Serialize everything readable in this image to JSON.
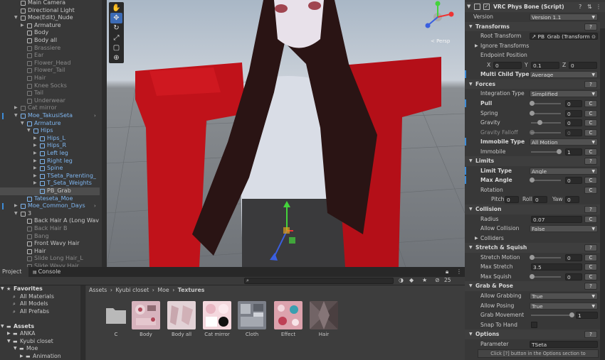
{
  "hierarchy": {
    "items": [
      {
        "label": "Main Camera",
        "indent": 1,
        "state": "normal",
        "arrow": ""
      },
      {
        "label": "Directional Light",
        "indent": 1,
        "state": "normal",
        "arrow": ""
      },
      {
        "label": "Moe(Edit)_Nude",
        "indent": 1,
        "state": "normal",
        "arrow": "down"
      },
      {
        "label": "Armature",
        "indent": 2,
        "state": "normal",
        "arrow": "right"
      },
      {
        "label": "Body",
        "indent": 2,
        "state": "normal",
        "arrow": ""
      },
      {
        "label": "Body all",
        "indent": 2,
        "state": "normal",
        "arrow": ""
      },
      {
        "label": "Brassiere",
        "indent": 2,
        "state": "dim",
        "arrow": ""
      },
      {
        "label": "Ear",
        "indent": 2,
        "state": "dim",
        "arrow": ""
      },
      {
        "label": "Flower_Head",
        "indent": 2,
        "state": "dim",
        "arrow": ""
      },
      {
        "label": "Flower_Tail",
        "indent": 2,
        "state": "dim",
        "arrow": ""
      },
      {
        "label": "Hair",
        "indent": 2,
        "state": "dim",
        "arrow": ""
      },
      {
        "label": "Knee Socks",
        "indent": 2,
        "state": "dim",
        "arrow": ""
      },
      {
        "label": "Tail",
        "indent": 2,
        "state": "dim",
        "arrow": ""
      },
      {
        "label": "Underwear",
        "indent": 2,
        "state": "dim",
        "arrow": ""
      },
      {
        "label": "Cat mirror",
        "indent": 1,
        "state": "dim",
        "arrow": "right"
      },
      {
        "label": "Moe_TakusiSeta",
        "indent": 1,
        "state": "blue",
        "arrow": "down"
      },
      {
        "label": "Armature",
        "indent": 2,
        "state": "blue",
        "arrow": "down"
      },
      {
        "label": "Hips",
        "indent": 3,
        "state": "blue",
        "arrow": "down"
      },
      {
        "label": "Hips_L",
        "indent": 4,
        "state": "blue",
        "arrow": "right"
      },
      {
        "label": "Hips_R",
        "indent": 4,
        "state": "blue",
        "arrow": "right"
      },
      {
        "label": "Left leg",
        "indent": 4,
        "state": "blue",
        "arrow": "right"
      },
      {
        "label": "Right leg",
        "indent": 4,
        "state": "blue",
        "arrow": "right"
      },
      {
        "label": "Spine",
        "indent": 4,
        "state": "blue",
        "arrow": "right"
      },
      {
        "label": "TSeta_Parenting_",
        "indent": 4,
        "state": "blue",
        "arrow": "right"
      },
      {
        "label": "T_Seta_Weights",
        "indent": 4,
        "state": "blue",
        "arrow": "right"
      },
      {
        "label": "PB_Grab",
        "indent": 4,
        "state": "selected",
        "arrow": ""
      },
      {
        "label": "Tateseta_Moe",
        "indent": 2,
        "state": "blue",
        "arrow": ""
      },
      {
        "label": "Moe_Common_Days",
        "indent": 1,
        "state": "blue",
        "arrow": "right"
      },
      {
        "label": "3",
        "indent": 1,
        "state": "normal",
        "arrow": "down"
      },
      {
        "label": "Back Hair A (Long Wav",
        "indent": 2,
        "state": "normal",
        "arrow": ""
      },
      {
        "label": "Back Hair B",
        "indent": 2,
        "state": "dim",
        "arrow": ""
      },
      {
        "label": "Bang",
        "indent": 2,
        "state": "dim",
        "arrow": ""
      },
      {
        "label": "Front Wavy Hair",
        "indent": 2,
        "state": "normal",
        "arrow": ""
      },
      {
        "label": "Hair",
        "indent": 2,
        "state": "normal",
        "arrow": ""
      },
      {
        "label": "Slide Long Hair_L",
        "indent": 2,
        "state": "dim",
        "arrow": ""
      },
      {
        "label": "Slide Wavy Hair",
        "indent": 2,
        "state": "dim",
        "arrow": ""
      }
    ]
  },
  "scene": {
    "persp_label": "< Persp",
    "tools": [
      "hand-tool",
      "move-tool",
      "rotate-tool",
      "scale-tool",
      "rect-tool",
      "transform-tool"
    ]
  },
  "inspector": {
    "component_title": "VRC Phys Bone (Script)",
    "help": "?",
    "version_label": "Version",
    "version_value": "Version 1.1",
    "transforms_header": "Transforms",
    "root_transform_label": "Root Transform",
    "root_transform_value": "↗ PB_Grab (Transform",
    "ignore_transforms_label": "Ignore Transforms",
    "endpoint_position_label": "Endpoint Position",
    "endpoint": {
      "x_label": "X",
      "x": "0",
      "y_label": "Y",
      "y": "0.1",
      "z_label": "Z",
      "z": "0"
    },
    "multi_child_label": "Multi Child Type",
    "multi_child_value": "Average",
    "forces_header": "Forces",
    "integration_label": "Integration Type",
    "integration_value": "Simplified",
    "pull_label": "Pull",
    "pull_value": "0",
    "spring_label": "Spring",
    "spring_value": "0",
    "gravity_label": "Gravity",
    "gravity_value": "0",
    "gravity_falloff_label": "Gravity Falloff",
    "gravity_falloff_value": "0",
    "immobile_type_label": "Immobile Type",
    "immobile_type_value": "All Motion",
    "immobile_label": "Immobile",
    "immobile_value": "1",
    "limits_header": "Limits",
    "limit_type_label": "Limit Type",
    "limit_type_value": "Angle",
    "max_angle_label": "Max Angle",
    "max_angle_value": "0",
    "rotation_label": "Rotation",
    "rotation": {
      "pitch_label": "Pitch",
      "pitch": "0",
      "roll_label": "Roll",
      "roll": "0",
      "yaw_label": "Yaw",
      "yaw": "0"
    },
    "collision_header": "Collision",
    "radius_label": "Radius",
    "radius_value": "0.07",
    "allow_collision_label": "Allow Collision",
    "allow_collision_value": "False",
    "colliders_label": "Colliders",
    "stretch_header": "Stretch & Squish",
    "stretch_motion_label": "Stretch Motion",
    "stretch_motion_value": "0",
    "max_stretch_label": "Max Stretch",
    "max_stretch_value": "3.5",
    "max_squish_label": "Max Squish",
    "max_squish_value": "0",
    "grab_header": "Grab & Pose",
    "allow_grabbing_label": "Allow Grabbing",
    "allow_grabbing_value": "True",
    "allow_posing_label": "Allow Posing",
    "allow_posing_value": "True",
    "grab_movement_label": "Grab Movement",
    "grab_movement_value": "1",
    "snap_label": "Snap To Hand",
    "options_header": "Options",
    "parameter_label": "Parameter",
    "parameter_value": "TSeta",
    "footer_hint": "Click [?] button in the Options section to",
    "c_label": "C",
    "levels": {
      "pull": 0.0,
      "spring": 0.0,
      "gravity": 0.3,
      "gravity_falloff": 0.0,
      "immobile": 1.0,
      "max_angle": 0.0,
      "stretch_motion": 0.0,
      "max_squish": 0.0,
      "grab_movement": 1.0
    }
  },
  "project": {
    "tabs": [
      "Project",
      "Console"
    ],
    "hidden_count": "25",
    "breadcrumb": [
      "Assets",
      "Kyubi closet",
      "Moe",
      "Textures"
    ],
    "sidebar": [
      {
        "label": "Favorites",
        "indent": 0,
        "bold": true,
        "arrow": "down",
        "icon": "star-icon"
      },
      {
        "label": "All Materials",
        "indent": 1,
        "bold": false,
        "arrow": "",
        "icon": "search-icon"
      },
      {
        "label": "All Models",
        "indent": 1,
        "bold": false,
        "arrow": "",
        "icon": "search-icon"
      },
      {
        "label": "All Prefabs",
        "indent": 1,
        "bold": false,
        "arrow": "",
        "icon": "search-icon"
      },
      {
        "label": "",
        "indent": 0,
        "bold": false,
        "arrow": "",
        "icon": ""
      },
      {
        "label": "Assets",
        "indent": 0,
        "bold": true,
        "arrow": "down",
        "icon": "folder-icon"
      },
      {
        "label": "ANKA",
        "indent": 1,
        "bold": false,
        "arrow": "right",
        "icon": "folder-icon"
      },
      {
        "label": "Kyubi closet",
        "indent": 1,
        "bold": false,
        "arrow": "down",
        "icon": "folder-icon"
      },
      {
        "label": "Moe",
        "indent": 2,
        "bold": false,
        "arrow": "down",
        "icon": "folder-icon"
      },
      {
        "label": "Animation",
        "indent": 3,
        "bold": false,
        "arrow": "right",
        "icon": "folder-icon"
      }
    ],
    "assets": [
      {
        "name": "C",
        "kind": "folder"
      },
      {
        "name": "Body",
        "kind": "texture"
      },
      {
        "name": "Body all",
        "kind": "texture"
      },
      {
        "name": "Cat mirror",
        "kind": "texture"
      },
      {
        "name": "Cloth",
        "kind": "texture"
      },
      {
        "name": "Effect",
        "kind": "texture"
      },
      {
        "name": "Hair",
        "kind": "texture"
      }
    ]
  },
  "colors": {
    "selection": "#3d8bd6",
    "accent_blue": "#7fb6f0",
    "panel": "#383838",
    "jacket_red": "#c0121a"
  }
}
